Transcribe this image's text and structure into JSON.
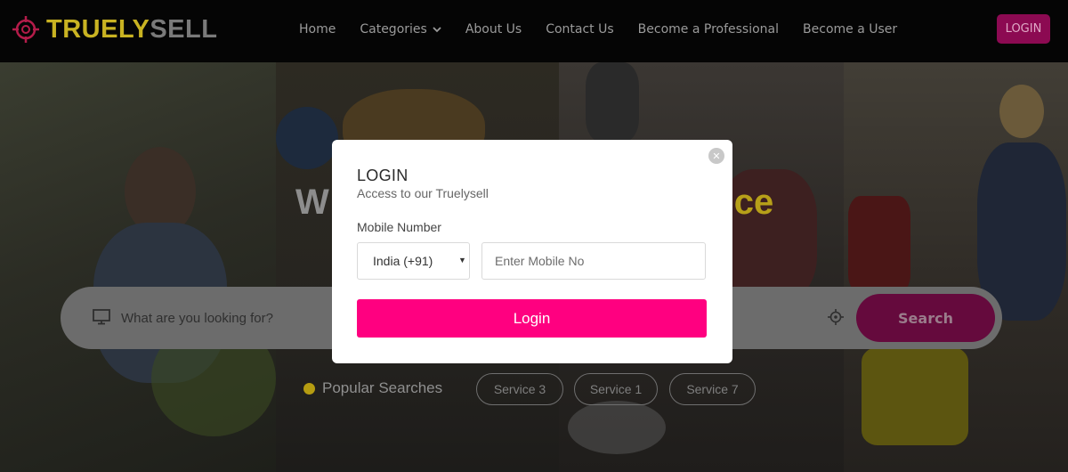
{
  "brand": {
    "name_part1": "TRUELY",
    "name_part2": "SELL",
    "logo_icon": "crosshair-logo-icon",
    "colors": {
      "accent_yellow": "#c9b322",
      "brand_gray": "#7a7a7a",
      "primary_pink": "#ff0080",
      "header_bg": "#050505"
    }
  },
  "nav": {
    "items": [
      {
        "label": "Home"
      },
      {
        "label": "Categories",
        "icon": "chevron-down-icon"
      },
      {
        "label": "About Us"
      },
      {
        "label": "Contact Us"
      },
      {
        "label": "Become a Professional"
      },
      {
        "label": "Become a User"
      }
    ],
    "login_label": "LOGIN"
  },
  "hero": {
    "title_start": "W",
    "title_end": "ce"
  },
  "search": {
    "placeholder": "What are you looking for?",
    "button_label": "Search",
    "monitor_icon": "monitor-icon",
    "locate_icon": "crosshair-locate-icon"
  },
  "popular": {
    "label": "Popular Searches",
    "chips": [
      "Service 3",
      "Service 1",
      "Service 7"
    ]
  },
  "modal": {
    "title": "LOGIN",
    "subtitle": "Access to our Truelysell",
    "field_label": "Mobile Number",
    "country_value": "India (+91)",
    "mobile_placeholder": "Enter Mobile No",
    "submit_label": "Login",
    "close_icon": "close-icon"
  }
}
